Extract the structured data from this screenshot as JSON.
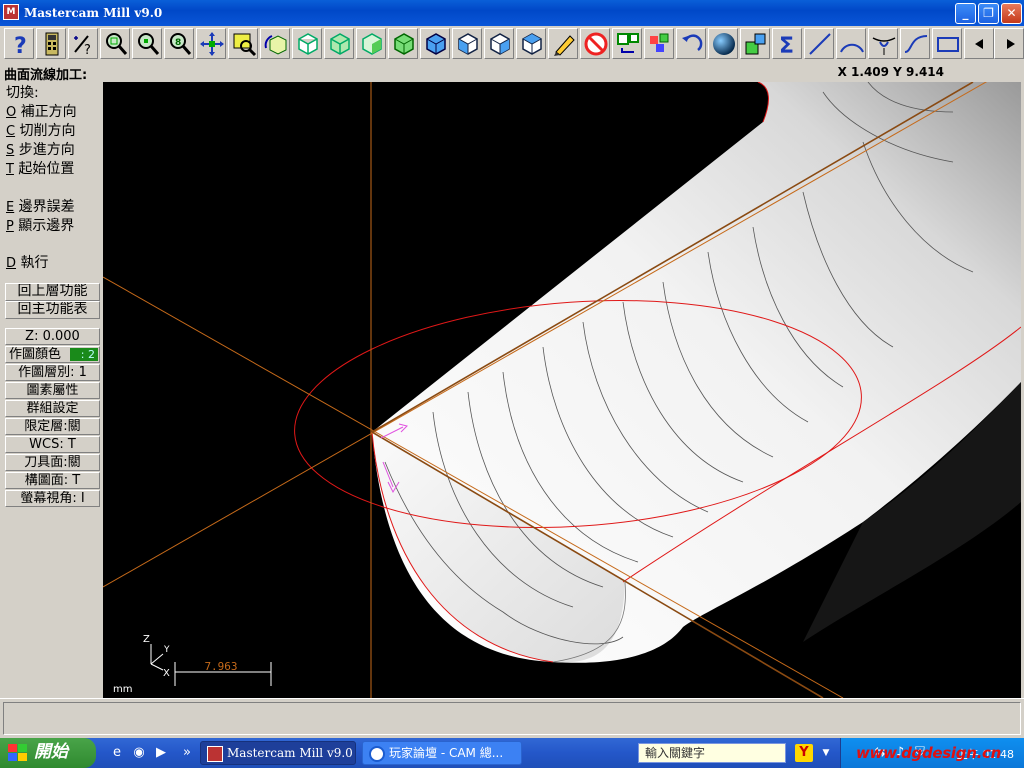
{
  "window": {
    "title": "Mastercam Mill v9.0",
    "app_icon_label": "M",
    "minimize_label": "_",
    "maximize_label": "❐",
    "close_label": "✕"
  },
  "toolbar": {
    "help_label": "?",
    "icons": [
      "help-icon",
      "calculator-icon",
      "analyze-icon",
      "zoom-icon",
      "unzoom-icon",
      "fit-icon",
      "pan-icon",
      "select-icon",
      "rotate-icon",
      "cube-top-icon",
      "cube-front-icon",
      "cube-side-icon",
      "cube-iso-icon",
      "cube-blue-top-icon",
      "cube-blue-front-icon",
      "cube-blue-side-icon",
      "cube-blue-iso-icon",
      "pencil-icon",
      "no-entry-icon",
      "transform-icon",
      "layers-icon",
      "undo-icon",
      "sphere-icon",
      "group-icon",
      "sigma-icon",
      "line-icon",
      "arc-icon",
      "fillet-icon",
      "spline-icon",
      "rectangle-icon",
      "arrow-left-icon",
      "arrow-right-icon"
    ]
  },
  "prompt": {
    "text": "曲面流線加工:",
    "coords": "X 1.409   Y 9.414"
  },
  "menu": {
    "header": "切換:",
    "items": [
      {
        "key": "O",
        "label": "補正方向"
      },
      {
        "key": "C",
        "label": "切削方向"
      },
      {
        "key": "S",
        "label": "步進方向"
      },
      {
        "key": "T",
        "label": "起始位置"
      },
      {
        "key": "E",
        "label": "邊界誤差"
      },
      {
        "key": "P",
        "label": "顯示邊界"
      },
      {
        "key": "D",
        "label": "執行"
      }
    ],
    "nav_buttons": [
      "回上層功能",
      "回主功能表"
    ],
    "status_buttons": [
      {
        "label": "Z:  0.000"
      },
      {
        "label": "作圖顏色",
        "chip": ": 2"
      },
      {
        "label": "作圖層別: 1"
      },
      {
        "label": "圖素屬性"
      },
      {
        "label": "群組設定"
      },
      {
        "label": "限定層:關"
      },
      {
        "label": "WCS:  T"
      },
      {
        "label": "刀具面:關"
      },
      {
        "label": "構圖面: T"
      },
      {
        "label": "螢幕視角: I"
      }
    ]
  },
  "viewport": {
    "axis_labels": {
      "z": "Z",
      "y": "Y",
      "x": "X"
    },
    "scale_value": "7.963",
    "units": "mm"
  },
  "taskbar": {
    "start_label": "開始",
    "tasks": [
      {
        "label": "Mastercam Mill v9.0"
      },
      {
        "label": "玩家論壇 - CAM 總..."
      }
    ],
    "search_placeholder": "輸入關鍵字",
    "clock": "上午 01:48",
    "watermark": "www.dgdesign.cn"
  }
}
